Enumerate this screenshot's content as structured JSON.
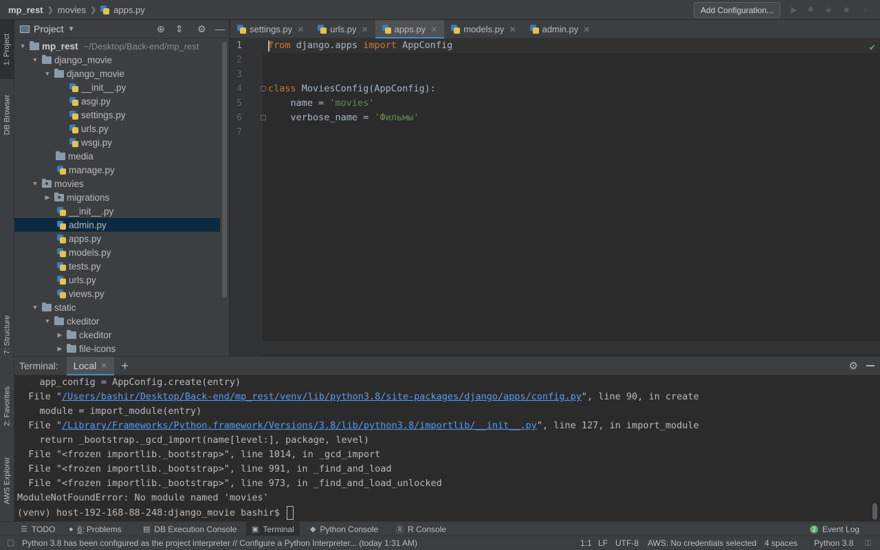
{
  "navbar": {
    "project": "mp_rest",
    "folder": "movies",
    "file": "apps.py",
    "add_config": "Add Configuration..."
  },
  "left_strip": {
    "project_tab": "1: Project",
    "db_tab": "DB Browser",
    "structure_tab": "7: Structure",
    "favorites_tab": "2: Favorites",
    "aws_tab": "AWS Explorer"
  },
  "project_panel": {
    "title": "Project",
    "root_name": "mp_rest",
    "root_path": "~/Desktop/Back-end/mp_rest",
    "tree": [
      {
        "label": "django_movie"
      },
      {
        "label": "django_movie"
      },
      {
        "label": "__init__.py"
      },
      {
        "label": "asgi.py"
      },
      {
        "label": "settings.py"
      },
      {
        "label": "urls.py"
      },
      {
        "label": "wsgi.py"
      },
      {
        "label": "media"
      },
      {
        "label": "manage.py"
      },
      {
        "label": "movies"
      },
      {
        "label": "migrations"
      },
      {
        "label": "__init__.py"
      },
      {
        "label": "admin.py"
      },
      {
        "label": "apps.py"
      },
      {
        "label": "models.py"
      },
      {
        "label": "tests.py"
      },
      {
        "label": "urls.py"
      },
      {
        "label": "views.py"
      },
      {
        "label": "static"
      },
      {
        "label": "ckeditor"
      },
      {
        "label": "ckeditor"
      },
      {
        "label": "file-icons"
      }
    ]
  },
  "tabs": [
    {
      "label": "settings.py"
    },
    {
      "label": "urls.py"
    },
    {
      "label": "apps.py"
    },
    {
      "label": "models.py"
    },
    {
      "label": "admin.py"
    }
  ],
  "editor": {
    "line_numbers": [
      "1",
      "2",
      "3",
      "4",
      "5",
      "6",
      "7"
    ],
    "code": {
      "l1_kw1": "from",
      "l1_mod": " django.apps ",
      "l1_kw2": "import",
      "l1_name": " AppConfig",
      "l4_kw": "class",
      "l4_rest": " MoviesConfig(AppConfig):",
      "l5_attr": "    name = ",
      "l5_str": "'movies'",
      "l6_attr": "    verbose_name = ",
      "l6_str": "'Фильмы'"
    }
  },
  "terminal": {
    "label": "Terminal:",
    "tab": "Local",
    "lines": {
      "t1": "    app_config = AppConfig.create(entry)",
      "t2_pre": "  File \"",
      "t2_link": "/Users/bashir/Desktop/Back-end/mp_rest/venv/lib/python3.8/site-packages/django/apps/config.py",
      "t2_post": "\", line 90, in create",
      "t3": "    module = import_module(entry)",
      "t4_pre": "  File \"",
      "t4_link": "/Library/Frameworks/Python.framework/Versions/3.8/lib/python3.8/importlib/__init__.py",
      "t4_post": "\", line 127, in import_module",
      "t5": "    return _bootstrap._gcd_import(name[level:], package, level)",
      "t6": "  File \"<frozen importlib._bootstrap>\", line 1014, in _gcd_import",
      "t7": "  File \"<frozen importlib._bootstrap>\", line 991, in _find_and_load",
      "t8": "  File \"<frozen importlib._bootstrap>\", line 973, in _find_and_load_unlocked",
      "t9": "ModuleNotFoundError: No module named 'movies'",
      "t10": "(venv) host-192-168-88-248:django_movie bashir$ "
    }
  },
  "tool_tabs": {
    "todo": "TODO",
    "problems_num": "6",
    "problems": ": Problems",
    "db_console": "DB Execution Console",
    "terminal": "Terminal",
    "python_console": "Python Console",
    "r_console": "R Console",
    "event_count": "2",
    "event_log": "Event Log"
  },
  "status": {
    "message": "Python 3.8 has been configured as the project interpreter // Configure a Python Interpreter... (today 1:31 AM)",
    "position": "1:1",
    "line_sep": "LF",
    "encoding": "UTF-8",
    "aws": "AWS: No credentials selected",
    "indent": "4 spaces",
    "interpreter": "Python 3.8"
  },
  "colors": {
    "keyword": "#cc7832",
    "string": "#6a8759",
    "link": "#589df6",
    "accent": "#4a88c7",
    "selection": "#0d293e"
  }
}
